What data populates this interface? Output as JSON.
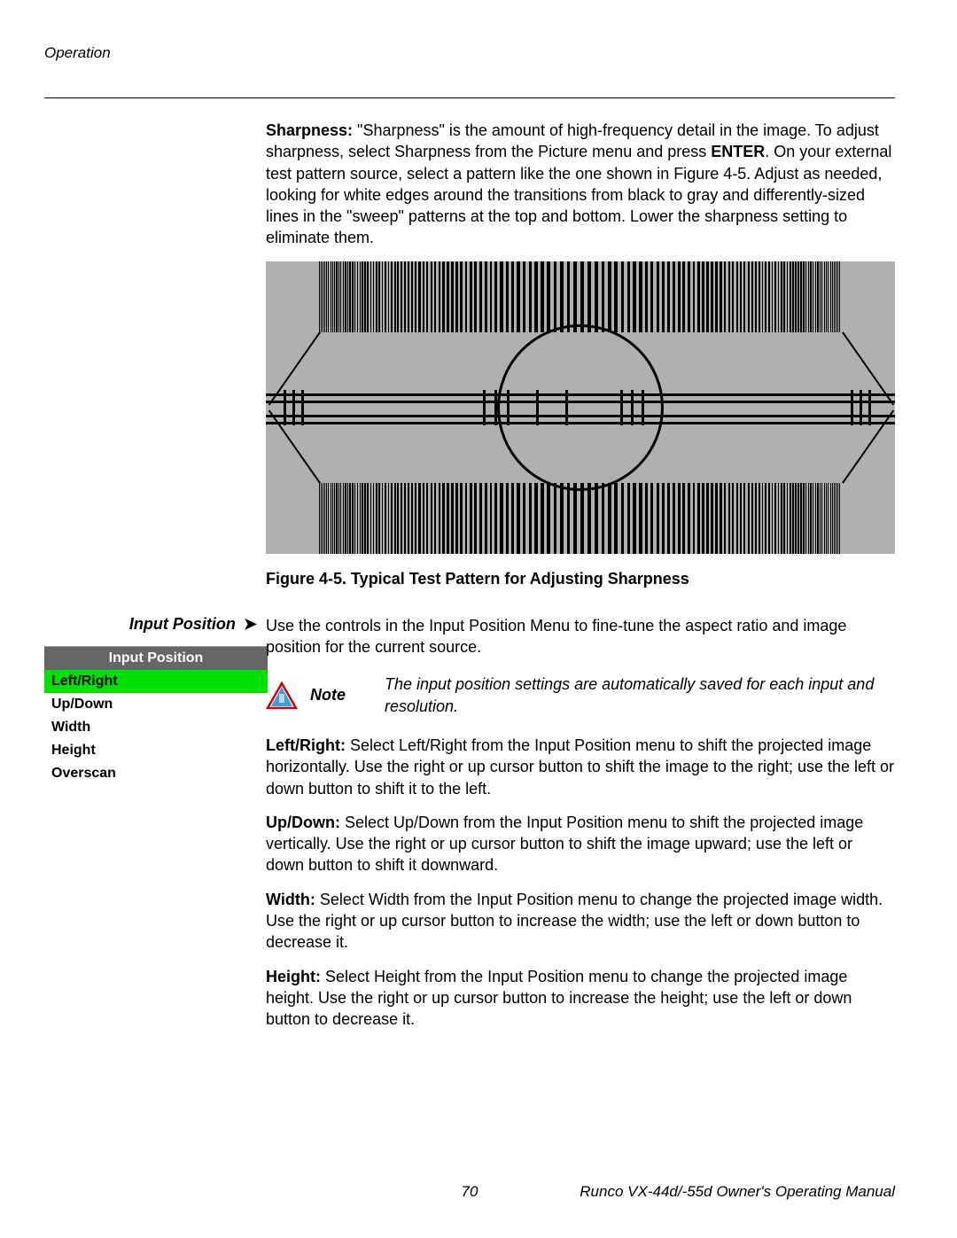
{
  "header": {
    "section": "Operation"
  },
  "sharpness": {
    "label": "Sharpness:",
    "body_part1": " \"Sharpness\" is the amount of high-frequency detail in the image. To adjust sharpness, select Sharpness from the Picture menu and press ",
    "enter": "ENTER",
    "body_part2": ". On your external test pattern source, select a pattern like the one shown in Figure 4-5. Adjust as needed, looking for white edges around the transitions from black to gray and differently-sized lines in the \"sweep\" patterns at the top and bottom. Lower the sharpness setting to eliminate them."
  },
  "figure": {
    "caption": "Figure 4-5. Typical Test Pattern for Adjusting Sharpness"
  },
  "input_position": {
    "side_label": "Input Position",
    "intro": "Use the controls in the Input Position Menu to fine-tune the aspect ratio and image position for the current source.",
    "menu": {
      "title": "Input Position",
      "items": [
        "Left/Right",
        "Up/Down",
        "Width",
        "Height",
        "Overscan"
      ],
      "selected_index": 0
    },
    "note": {
      "label": "Note",
      "text": "The input position settings are automatically saved for each input and resolution."
    },
    "left_right": {
      "label": "Left/Right:",
      "text": " Select Left/Right from the Input Position menu to shift the projected image horizontally. Use the right or up cursor button to shift the image to the right; use the left or down button to shift it to the left."
    },
    "up_down": {
      "label": "Up/Down:",
      "text": " Select Up/Down from the Input Position menu to shift the projected image vertically. Use the right or up cursor button to shift the image upward; use the left or down button to shift it downward."
    },
    "width": {
      "label": "Width:",
      "text": " Select Width from the Input Position menu to change the projected image width. Use the right or up cursor button to increase the width; use the left or down button to decrease it."
    },
    "height": {
      "label": "Height:",
      "text": " Select Height from the Input Position menu to change the projected image height. Use the right or up cursor button to increase the height; use the left or down button to decrease it."
    }
  },
  "footer": {
    "page": "70",
    "title": "Runco VX-44d/-55d Owner's Operating Manual"
  }
}
